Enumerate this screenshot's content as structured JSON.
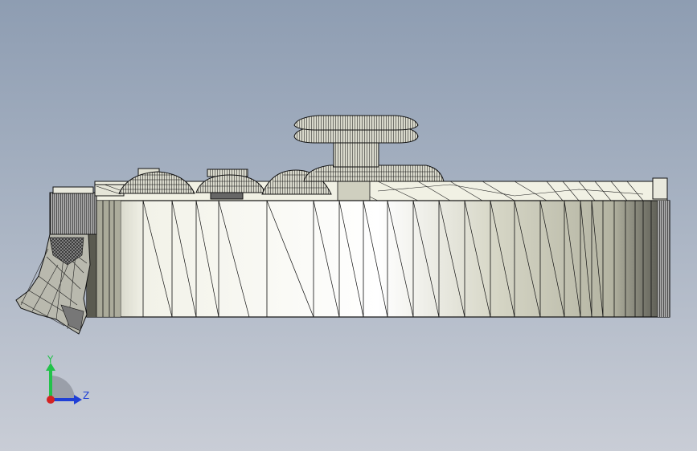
{
  "viewport": {
    "background_top": "#8e9db2",
    "background_bottom": "#c9cdd6"
  },
  "triad": {
    "y_label": "Y",
    "z_label": "Z",
    "y_color": "#22c24a",
    "z_color": "#1f3fd6",
    "x_color": "#d42222"
  },
  "model": {
    "description_icon": "cad-mesh-model",
    "mesh_color": "#000000",
    "fill_light": "#f7f7ee",
    "fill_mid": "#d8d8c8",
    "fill_dark": "#8c8c7c"
  }
}
